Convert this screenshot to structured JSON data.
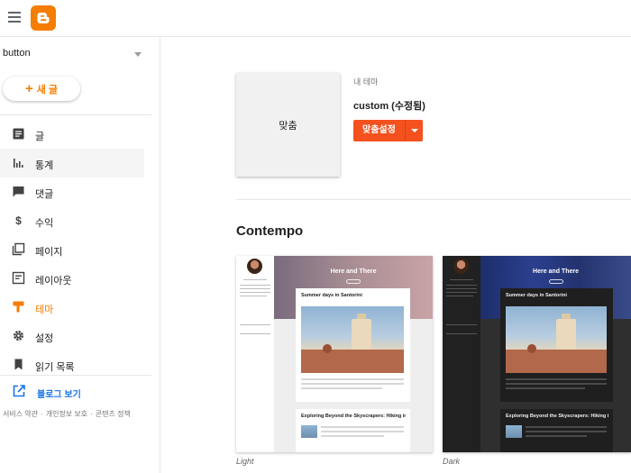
{
  "app": {
    "name": "Blogger"
  },
  "sidebar": {
    "blog_name": "button",
    "new_post_label": "새 글",
    "items": [
      {
        "label": "글",
        "icon": "posts-icon"
      },
      {
        "label": "통계",
        "icon": "stats-icon"
      },
      {
        "label": "댓글",
        "icon": "comments-icon"
      },
      {
        "label": "수익",
        "icon": "earnings-icon"
      },
      {
        "label": "페이지",
        "icon": "pages-icon"
      },
      {
        "label": "레이아웃",
        "icon": "layout-icon"
      },
      {
        "label": "테마",
        "icon": "theme-icon"
      },
      {
        "label": "설정",
        "icon": "settings-icon"
      },
      {
        "label": "읽기 목록",
        "icon": "reading-list-icon"
      }
    ],
    "view_blog_label": "블로그 보기",
    "footer": {
      "terms": "서비스 약관",
      "privacy": "개인정보 보호",
      "content_policy": "콘텐츠 정책"
    }
  },
  "main": {
    "current_theme": {
      "thumbnail_label": "맞춤",
      "section_label": "내 테마",
      "name": "custom (수정됨)",
      "customize_label": "맞춤설정"
    },
    "gallery": {
      "title": "Contempo",
      "themes": [
        {
          "caption": "Light",
          "blog_title": "Here and There",
          "post1": "Summer days in Santorini",
          "post2": "Exploring Beyond the Skyscrapers: Hiking in Hong Kong"
        },
        {
          "caption": "Dark",
          "blog_title": "Here and There",
          "post1": "Summer days in Santorini",
          "post2": "Exploring Beyond the Skyscrapers: Hiking in Hong Kong"
        }
      ]
    }
  },
  "colors": {
    "accent": "#f57d00",
    "button": "#f4511e",
    "link": "#1a73e8"
  }
}
